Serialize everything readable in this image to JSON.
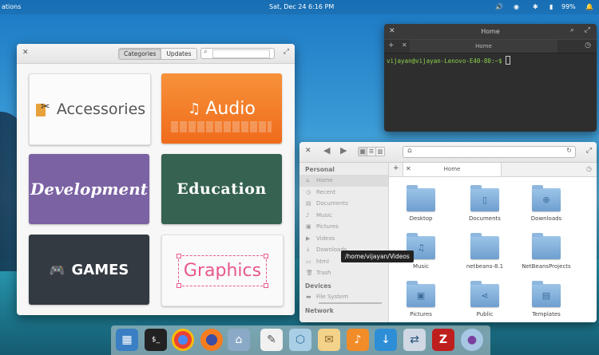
{
  "panel": {
    "applications": "ations",
    "date": "Sat, Dec 24",
    "time": "6:16 PM",
    "battery": "99%"
  },
  "appcenter": {
    "segments": [
      "Categories",
      "Updates"
    ],
    "search_value": "",
    "categories": [
      "Accessories",
      "Audio",
      "Development",
      "Education",
      "GAMES",
      "Graphics"
    ]
  },
  "terminal": {
    "title": "Home",
    "tab_label": "Home",
    "prompt": "vijayan@vijayan-Lenovo-E40-80:~$"
  },
  "files": {
    "tab_label": "Home",
    "sidebar": {
      "personal_header": "Personal",
      "items": [
        "Home",
        "Recent",
        "Documents",
        "Music",
        "Pictures",
        "Videos",
        "Downloads",
        "html",
        "Trash"
      ],
      "devices_header": "Devices",
      "device": "File System",
      "network_header": "Network"
    },
    "items": [
      "Desktop",
      "Documents",
      "Downloads",
      "Music",
      "netbeans-8.1",
      "NetBeansProjects",
      "Pictures",
      "Public",
      "Templates"
    ]
  },
  "tooltip": "/home/vijayan/Videos",
  "dock": {
    "icons": [
      "multitasking-view",
      "terminal",
      "chrome",
      "firefox",
      "files",
      "text-editor",
      "virtualbox",
      "mail",
      "music",
      "downloader",
      "network-tool",
      "filezilla",
      "pidgin"
    ],
    "colors": {
      "audio": "#ef7a2a",
      "development": "#7b62a3",
      "education": "#366251",
      "games": "#333a42",
      "graphics_text": "#e8578d"
    }
  }
}
